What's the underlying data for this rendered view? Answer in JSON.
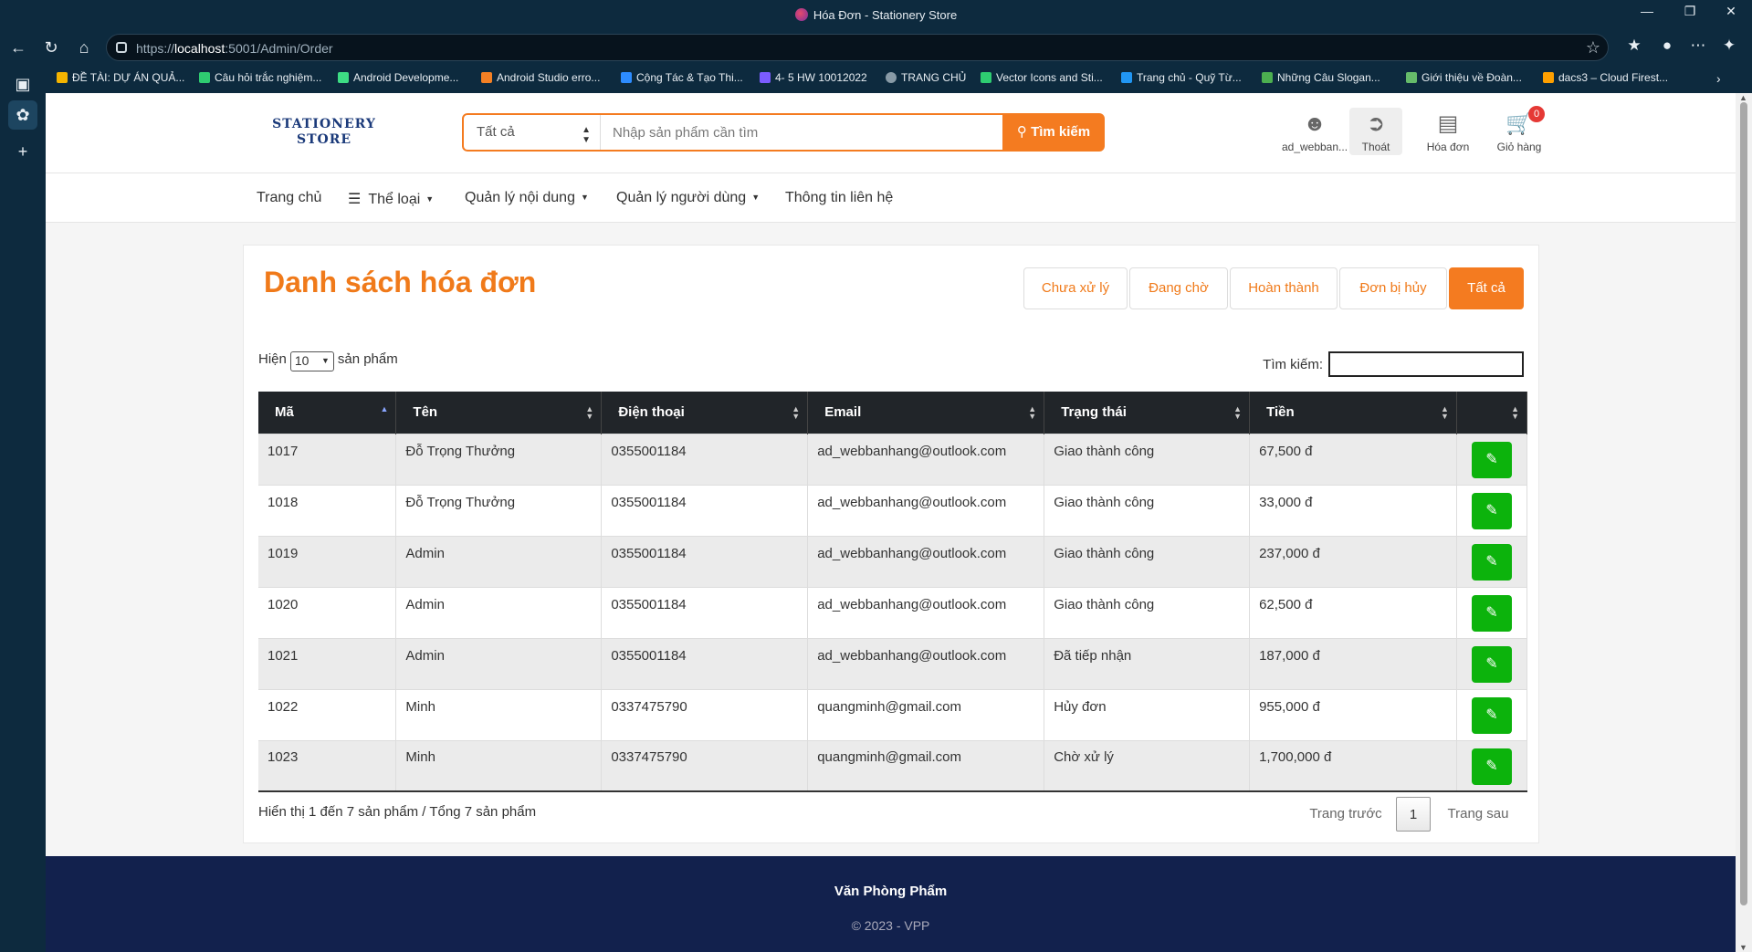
{
  "browser": {
    "tab_title": "Hóa Đơn - Stationery Store",
    "url_prefix": "https://",
    "url_host": "localhost",
    "url_rest": ":5001/Admin/Order",
    "bookmarks": [
      {
        "label": "ĐỀ TÀI: DỰ ÁN QUẢ...",
        "color": "#f4b400"
      },
      {
        "label": "Câu hỏi trắc nghiệm...",
        "color": "#2ecc71"
      },
      {
        "label": "Android Developme...",
        "color": "#3ddc84"
      },
      {
        "label": "Android Studio erro...",
        "color": "#f48024"
      },
      {
        "label": "Cộng Tác & Tạo Thi...",
        "color": "#2d8cff"
      },
      {
        "label": "4- 5 HW 10012022",
        "color": "#7b5cff"
      },
      {
        "label": "TRANG CHỦ",
        "color": "#9aa"
      },
      {
        "label": "Vector Icons and Sti...",
        "color": "#2ecc71"
      },
      {
        "label": "Trang chủ - Quỹ Từ...",
        "color": "#2196f3"
      },
      {
        "label": "Những Câu Slogan...",
        "color": "#4caf50"
      },
      {
        "label": "Giới thiệu về Đoàn...",
        "color": "#66bb6a"
      },
      {
        "label": "dacs3 – Cloud Firest...",
        "color": "#ffa000"
      }
    ]
  },
  "header": {
    "logo_line1": "STATIONERY",
    "logo_line2": "STORE",
    "search_category": "Tất cả",
    "search_placeholder": "Nhập sản phẩm cần tìm",
    "search_button": "Tìm kiếm",
    "user_label": "ad_webban...",
    "logout_label": "Thoát",
    "invoice_label": "Hóa đơn",
    "cart_label": "Giỏ hàng",
    "cart_count": "0"
  },
  "nav": {
    "home": "Trang chủ",
    "category": "Thể loại",
    "content_mgmt": "Quản lý nội dung",
    "user_mgmt": "Quản lý người dùng",
    "contact": "Thông tin liên hệ"
  },
  "orders": {
    "title": "Danh sách hóa đơn",
    "filters": [
      "Chưa xử lý",
      "Đang chờ",
      "Hoàn thành",
      "Đơn bị hủy",
      "Tất cả"
    ],
    "active_filter": "Tất cả",
    "show_prefix": "Hiện",
    "page_length": "10",
    "show_suffix": "sản phẩm",
    "search_label": "Tìm kiếm:",
    "columns": [
      "Mã",
      "Tên",
      "Điện thoại",
      "Email",
      "Trạng thái",
      "Tiền",
      ""
    ],
    "rows": [
      {
        "id": "1017",
        "name": "Đỗ Trọng Thưởng",
        "phone": "0355001184",
        "email": "ad_webbanhang@outlook.com",
        "status": "Giao thành công",
        "amount": "67,500 đ"
      },
      {
        "id": "1018",
        "name": "Đỗ Trọng Thưởng",
        "phone": "0355001184",
        "email": "ad_webbanhang@outlook.com",
        "status": "Giao thành công",
        "amount": "33,000 đ"
      },
      {
        "id": "1019",
        "name": "Admin",
        "phone": "0355001184",
        "email": "ad_webbanhang@outlook.com",
        "status": "Giao thành công",
        "amount": "237,000 đ"
      },
      {
        "id": "1020",
        "name": "Admin",
        "phone": "0355001184",
        "email": "ad_webbanhang@outlook.com",
        "status": "Giao thành công",
        "amount": "62,500 đ"
      },
      {
        "id": "1021",
        "name": "Admin",
        "phone": "0355001184",
        "email": "ad_webbanhang@outlook.com",
        "status": "Đã tiếp nhận",
        "amount": "187,000 đ"
      },
      {
        "id": "1022",
        "name": "Minh",
        "phone": "0337475790",
        "email": "quangminh@gmail.com",
        "status": "Hủy đơn",
        "amount": "955,000 đ"
      },
      {
        "id": "1023",
        "name": "Minh",
        "phone": "0337475790",
        "email": "quangminh@gmail.com",
        "status": "Chờ xử lý",
        "amount": "1,700,000 đ"
      }
    ],
    "info": "Hiển thị 1 đến 7 sản phẩm / Tổng 7 sản phẩm",
    "prev_label": "Trang trước",
    "current_page": "1",
    "next_label": "Trang sau"
  },
  "footer": {
    "line1": "Văn Phòng Phẩm",
    "line2": "© 2023 - VPP"
  },
  "colors": {
    "accent": "#f47b20",
    "edit_button": "#0cb30c",
    "table_header": "#212529",
    "footer_bg": "#12214d"
  }
}
